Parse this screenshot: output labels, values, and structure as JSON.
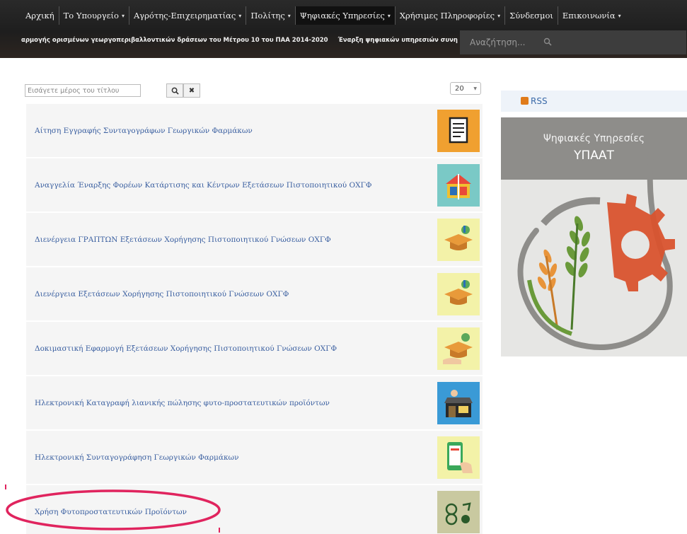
{
  "nav": {
    "items": [
      {
        "label": "Αρχική",
        "caret": false
      },
      {
        "label": "Το Υπουργείο",
        "caret": true
      },
      {
        "label": "Αγρότης-Επιχειρηματίας",
        "caret": true
      },
      {
        "label": "Πολίτης",
        "caret": true
      },
      {
        "label": "Ψηφιακές Υπηρεσίες",
        "caret": true
      },
      {
        "label": "Χρήσιμες Πληροφορίες",
        "caret": true
      },
      {
        "label": "Σύνδεσμοι",
        "caret": false
      },
      {
        "label": "Επικοινωνία",
        "caret": true
      }
    ],
    "caret_glyph": "▾"
  },
  "ticker": {
    "items": [
      "αρμογής ορισμένων γεωργοπεριβαλλοντικών δράσεων του Μέτρου 10 του ΠΑΑ 2014-2020",
      "Έναρξη ψηφιακών υπηρεσιών συνη"
    ]
  },
  "header_search": {
    "placeholder": "Αναζήτηση...",
    "icon": "search-icon"
  },
  "filter": {
    "placeholder": "Εισάγετε μέρος του τίτλου",
    "search_glyph": "🔍",
    "clear_glyph": "✖",
    "limit_value": "20"
  },
  "list": {
    "items": [
      {
        "title": "Αίτηση Εγγραφής Συνταγογράφων Γεωργικών Φαρμάκων",
        "icon": "document-icon"
      },
      {
        "title": "Αναγγελία Έναρξης Φορέων Κατάρτισης και Κέντρων Εξετάσεων Πιστοποιητικού ΟΧΓΦ",
        "icon": "training-centers-icon"
      },
      {
        "title": "Διενέργεια ΓΡΑΠΤΩΝ Εξετάσεων Χορήγησης Πιστοποιητικού Γνώσεων ΟΧΓΦ",
        "icon": "graduation-cap-icon"
      },
      {
        "title": "Διενέργεια Εξετάσεων Χορήγησης Πιστοποιητικού Γνώσεων ΟΧΓΦ",
        "icon": "graduation-cap-icon"
      },
      {
        "title": "Δοκιμαστική Εφαρμογή Εξετάσεων Χορήγησης Πιστοποιητικού Γνώσεων ΟΧΓΦ",
        "icon": "graduation-cap-hand-icon"
      },
      {
        "title": "Ηλεκτρονική Καταγραφή λιανικής πώλησης φυτο-προστατευτικών προϊόντων",
        "icon": "shop-icon"
      },
      {
        "title": "Ηλεκτρονική Συνταγογράφηση Γεωργικών Φαρμάκων",
        "icon": "mobile-prescription-icon"
      },
      {
        "title": "Χρήση Φυτοπροστατευτικών Προϊόντων",
        "icon": "plant-protection-icon"
      }
    ]
  },
  "sidebar": {
    "rss_label": "RSS",
    "banner_line1": "Ψηφιακές Υπηρεσίες",
    "banner_line2": "ΥΠΑΑΤ"
  },
  "colors": {
    "link": "#3a5fa0",
    "header_bg": "#222222",
    "row_bg": "#f5f5f5",
    "annotation": "#e0245e"
  }
}
